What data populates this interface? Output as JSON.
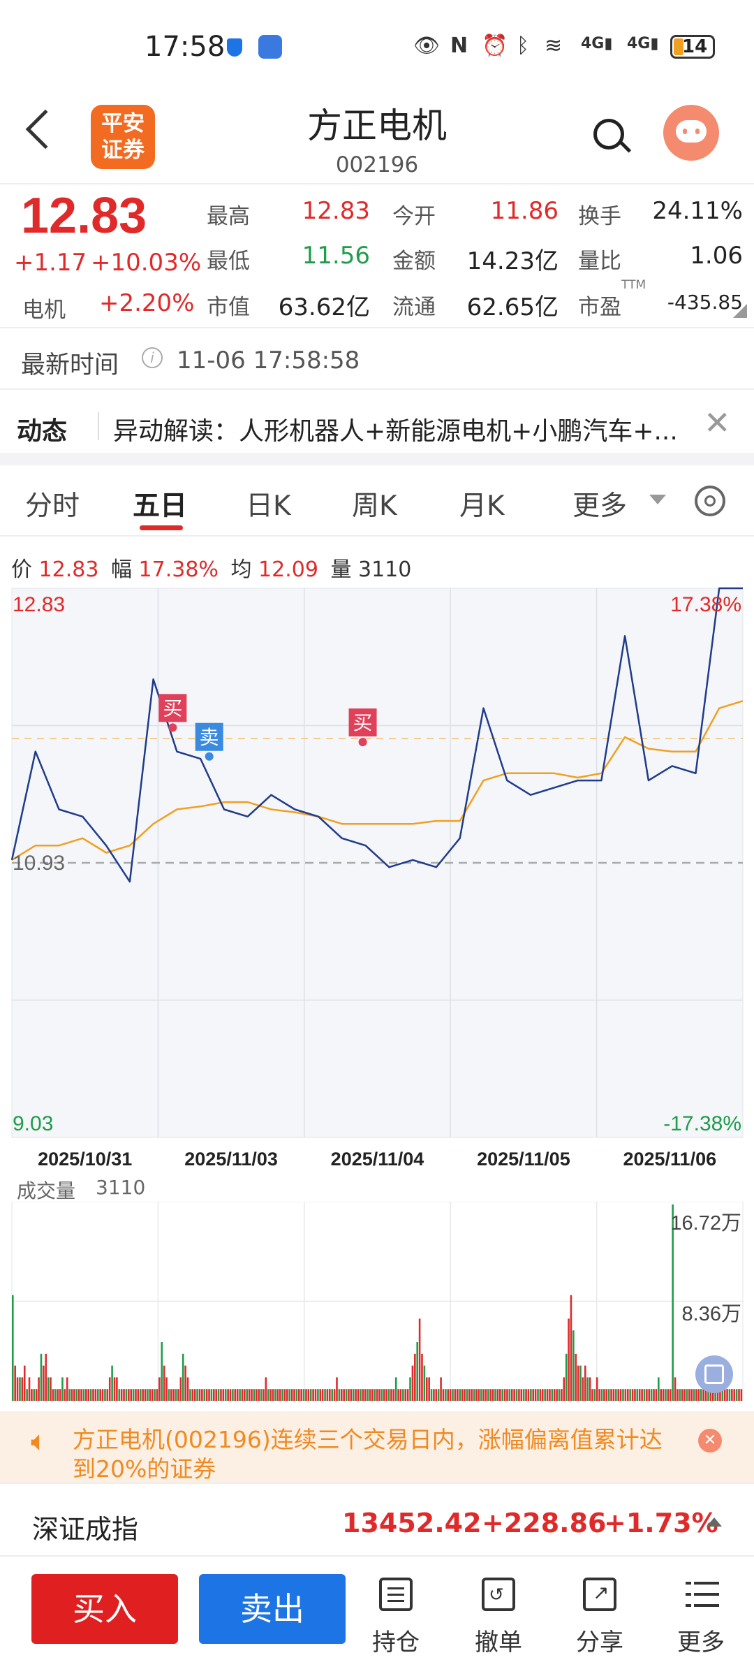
{
  "status_bar": {
    "time": "17:58",
    "battery": "14"
  },
  "header": {
    "logo_line1": "平安",
    "logo_line2": "证券",
    "title": "方正电机",
    "code": "002196"
  },
  "quote": {
    "price": "12.83",
    "change": "+1.17",
    "change_pct": "+10.03%",
    "sector_name": "电机",
    "sector_pct": "+2.20%",
    "stats": [
      {
        "label": "最高",
        "value": "12.83",
        "color": "red"
      },
      {
        "label": "今开",
        "value": "11.86",
        "color": "red"
      },
      {
        "label": "换手",
        "value": "24.11%",
        "color": "black"
      },
      {
        "label": "最低",
        "value": "11.56",
        "color": "green"
      },
      {
        "label": "金额",
        "value": "14.23亿",
        "color": "black"
      },
      {
        "label": "量比",
        "value": "1.06",
        "color": "black"
      },
      {
        "label": "市值",
        "value": "63.62亿",
        "color": "black"
      },
      {
        "label": "流通",
        "value": "62.65亿",
        "color": "black"
      },
      {
        "label": "市盈",
        "value": "-435.85",
        "color": "black"
      }
    ],
    "pe_tag": "TTM"
  },
  "update": {
    "label": "最新时间",
    "info_icon": "i",
    "time": "11-06 17:58:58"
  },
  "news": {
    "label": "动态",
    "text": "异动解读：人形机器人+新能源电机+小鹏汽车+..."
  },
  "tabs": [
    "分时",
    "五日",
    "日K",
    "周K",
    "月K",
    "更多"
  ],
  "chart_info": {
    "price_label": "价",
    "price": "12.83",
    "range_label": "幅",
    "range": "17.38%",
    "avg_label": "均",
    "avg": "12.09",
    "vol_label": "量",
    "vol": "3110"
  },
  "chart_data": {
    "type": "line",
    "y_top": "12.83",
    "y_top_pct": "17.38%",
    "y_ref": "10.93",
    "y_bottom": "9.03",
    "y_bottom_pct": "-17.38%",
    "ylim": [
      9.03,
      12.83
    ],
    "dates": [
      "2025/10/31",
      "2025/11/03",
      "2025/11/04",
      "2025/11/05",
      "2025/11/06"
    ],
    "price_series": [
      10.95,
      11.7,
      11.3,
      11.25,
      11.05,
      10.8,
      12.2,
      11.7,
      11.65,
      11.3,
      11.25,
      11.4,
      11.3,
      11.25,
      11.1,
      11.05,
      10.9,
      10.95,
      10.9,
      11.1,
      12.0,
      11.5,
      11.4,
      11.45,
      11.5,
      11.5,
      12.5,
      11.5,
      11.6,
      11.55,
      12.83,
      12.83
    ],
    "avg_series": [
      10.95,
      11.05,
      11.05,
      11.1,
      11.0,
      11.05,
      11.2,
      11.3,
      11.32,
      11.35,
      11.35,
      11.3,
      11.28,
      11.25,
      11.2,
      11.2,
      11.2,
      11.2,
      11.22,
      11.22,
      11.5,
      11.55,
      11.55,
      11.55,
      11.52,
      11.55,
      11.8,
      11.72,
      11.7,
      11.7,
      12.0,
      12.05
    ],
    "markers": [
      {
        "label": "买",
        "type": "buy"
      },
      {
        "label": "卖",
        "type": "sell"
      },
      {
        "label": "买",
        "type": "buy"
      }
    ],
    "volume": {
      "label": "成交量",
      "value": "3110",
      "max_label": "16.72万",
      "mid_label": "8.36万",
      "bars": [
        9,
        3,
        2,
        2,
        2,
        3,
        1,
        2,
        1,
        1,
        1,
        2,
        4,
        3,
        4,
        2,
        2,
        1,
        1,
        1,
        1,
        2,
        1,
        2,
        1,
        1,
        1,
        1,
        1,
        1,
        1,
        1,
        1,
        1,
        1,
        1,
        1,
        1,
        1,
        1,
        1,
        2,
        3,
        2,
        2,
        1,
        1,
        1,
        1,
        1,
        1,
        1,
        1,
        1,
        1,
        1,
        1,
        1,
        1,
        1,
        1,
        1,
        2,
        5,
        3,
        2,
        1,
        1,
        1,
        1,
        1,
        2,
        4,
        3,
        2,
        1,
        1,
        1,
        1,
        1,
        1,
        1,
        1,
        1,
        1,
        1,
        1,
        1,
        1,
        1,
        1,
        1,
        1,
        1,
        1,
        1,
        1,
        1,
        1,
        1,
        1,
        1,
        1,
        1,
        1,
        1,
        1,
        2,
        1,
        1,
        1,
        1,
        1,
        1,
        1,
        1,
        1,
        1,
        1,
        1,
        1,
        1,
        1,
        1,
        1,
        1,
        1,
        1,
        1,
        1,
        1,
        1,
        1,
        1,
        1,
        1,
        1,
        2,
        1,
        1,
        1,
        1,
        1,
        1,
        1,
        1,
        1,
        1,
        1,
        1,
        1,
        1,
        1,
        1,
        1,
        1,
        1,
        1,
        1,
        1,
        1,
        1,
        2,
        1,
        1,
        1,
        1,
        1,
        2,
        3,
        4,
        5,
        7,
        4,
        3,
        2,
        2,
        1,
        1,
        1,
        1,
        2,
        1,
        1,
        1,
        1,
        1,
        1,
        1,
        1,
        1,
        1,
        1,
        1,
        1,
        1,
        1,
        1,
        1,
        1,
        1,
        1,
        1,
        1,
        1,
        1,
        1,
        1,
        1,
        1,
        1,
        1,
        1,
        1,
        1,
        1,
        1,
        1,
        1,
        1,
        1,
        1,
        1,
        1,
        1,
        1,
        1,
        1,
        1,
        1,
        1,
        1,
        1,
        2,
        4,
        7,
        9,
        6,
        4,
        3,
        3,
        2,
        3,
        2,
        2,
        1,
        1,
        2,
        1,
        1,
        1,
        1,
        1,
        1,
        1,
        1,
        1,
        1,
        1,
        1,
        1,
        1,
        1,
        1,
        1,
        1,
        1,
        1,
        1,
        1,
        1,
        1,
        1,
        2,
        1,
        1,
        1,
        1,
        1,
        16.72,
        2,
        1,
        1,
        1,
        1,
        1,
        1,
        1,
        1,
        1,
        1,
        1,
        1,
        1,
        1,
        1,
        1,
        1,
        1,
        1,
        1,
        1,
        1,
        1,
        1,
        1,
        1,
        1,
        1
      ]
    }
  },
  "alert": {
    "text": "方正电机(002196)连续三个交易日内，涨幅偏离值累计达到20%的证券"
  },
  "index": {
    "name": "深证成指",
    "value": "13452.42",
    "change": "+228.86",
    "pct": "+1.73%"
  },
  "bottom_nav": {
    "buy": "买入",
    "sell": "卖出",
    "items": [
      "持仓",
      "撤单",
      "分享",
      "更多"
    ]
  },
  "colors": {
    "red": "#e02a2a",
    "green": "#1f9d4a",
    "blue": "#1d74e5",
    "price_line": "#1f3b8a",
    "avg_line": "#f0a020",
    "orange_bg": "#fcefe4"
  }
}
